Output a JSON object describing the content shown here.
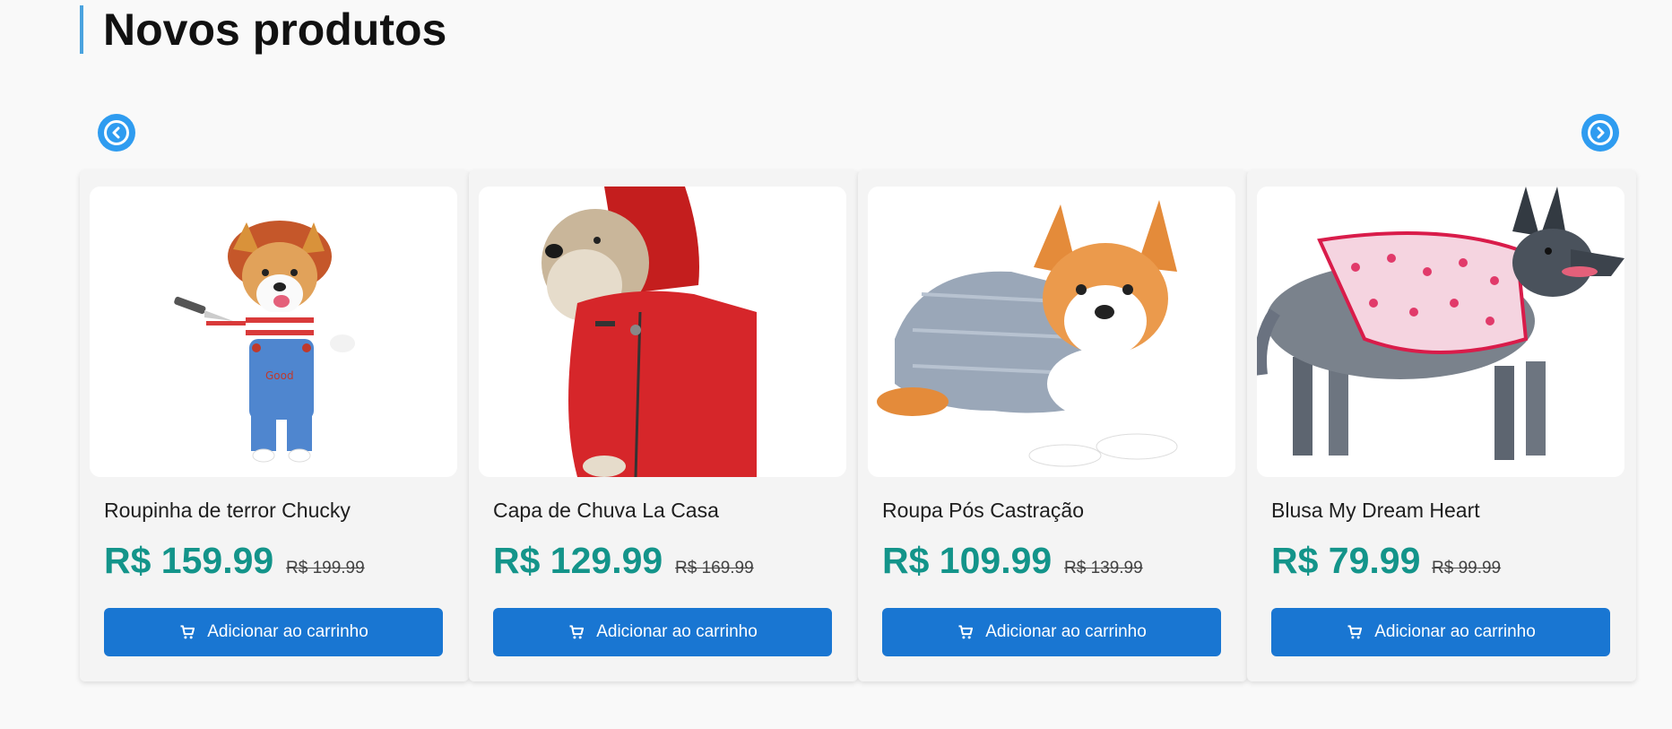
{
  "section": {
    "title": "Novos produtos"
  },
  "nav": {
    "prev_icon": "chevron-left-circle-icon",
    "next_icon": "chevron-right-circle-icon",
    "color": "#2f9cf0"
  },
  "products": [
    {
      "name": "Roupinha de terror Chucky",
      "price": "R$ 159.99",
      "old_price": "R$ 199.99",
      "button": "Adicionar ao carrinho",
      "image": "corgi-chucky-costume"
    },
    {
      "name": "Capa de Chuva La Casa",
      "price": "R$ 129.99",
      "old_price": "R$ 169.99",
      "button": "Adicionar ao carrinho",
      "image": "dog-red-raincoat"
    },
    {
      "name": "Roupa Pós Castração",
      "price": "R$ 109.99",
      "old_price": "R$ 139.99",
      "button": "Adicionar ao carrinho",
      "image": "corgi-recovery-suit"
    },
    {
      "name": "Blusa My Dream Heart",
      "price": "R$ 79.99",
      "old_price": "R$ 99.99",
      "button": "Adicionar ao carrinho",
      "image": "dog-heart-shirt"
    }
  ],
  "colors": {
    "price": "#13948a",
    "button": "#1976d2",
    "accent": "#4aa3df"
  }
}
